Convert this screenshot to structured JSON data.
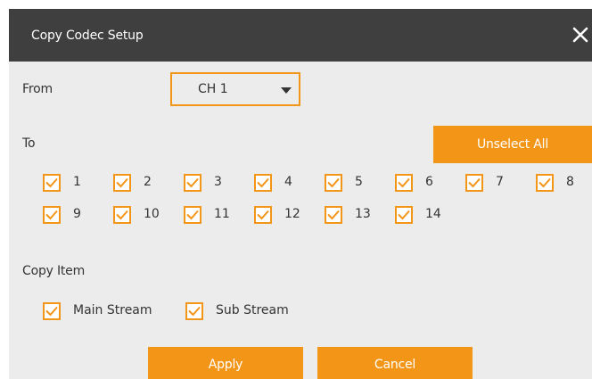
{
  "dialog": {
    "title": "Copy Codec Setup",
    "close_icon": "close-icon"
  },
  "from": {
    "label": "From",
    "selected": "CH 1"
  },
  "to": {
    "label": "To",
    "unselect_all": "Unselect All",
    "channels": [
      {
        "label": "1",
        "checked": true
      },
      {
        "label": "2",
        "checked": true
      },
      {
        "label": "3",
        "checked": true
      },
      {
        "label": "4",
        "checked": true
      },
      {
        "label": "5",
        "checked": true
      },
      {
        "label": "6",
        "checked": true
      },
      {
        "label": "7",
        "checked": true
      },
      {
        "label": "8",
        "checked": true
      },
      {
        "label": "9",
        "checked": true
      },
      {
        "label": "10",
        "checked": true
      },
      {
        "label": "11",
        "checked": true
      },
      {
        "label": "12",
        "checked": true
      },
      {
        "label": "13",
        "checked": true
      },
      {
        "label": "14",
        "checked": true
      }
    ]
  },
  "copy_item": {
    "label": "Copy Item",
    "items": [
      {
        "label": "Main Stream",
        "checked": true
      },
      {
        "label": "Sub Stream",
        "checked": true
      }
    ]
  },
  "actions": {
    "apply": "Apply",
    "cancel": "Cancel"
  },
  "colors": {
    "accent": "#f39517",
    "titlebar": "#3f3f3f",
    "background": "#ececec"
  }
}
